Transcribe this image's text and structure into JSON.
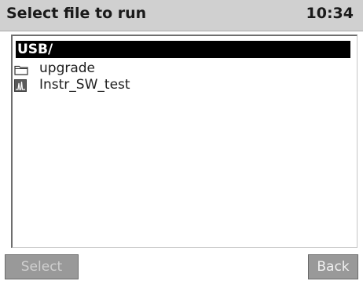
{
  "header": {
    "title": "Select file to run",
    "clock": "10:34"
  },
  "file_list": {
    "items": [
      {
        "label": "USB/",
        "icon": "none",
        "selected": true
      },
      {
        "label": "upgrade",
        "icon": "folder-icon",
        "selected": false
      },
      {
        "label": "Instr_SW_test",
        "icon": "method-file-icon",
        "selected": false
      }
    ]
  },
  "buttons": {
    "select_label": "Select",
    "back_label": "Back",
    "select_enabled": false
  },
  "colors": {
    "title_bar": "#d0d0d0",
    "selection": "#000000",
    "button": "#999999"
  }
}
